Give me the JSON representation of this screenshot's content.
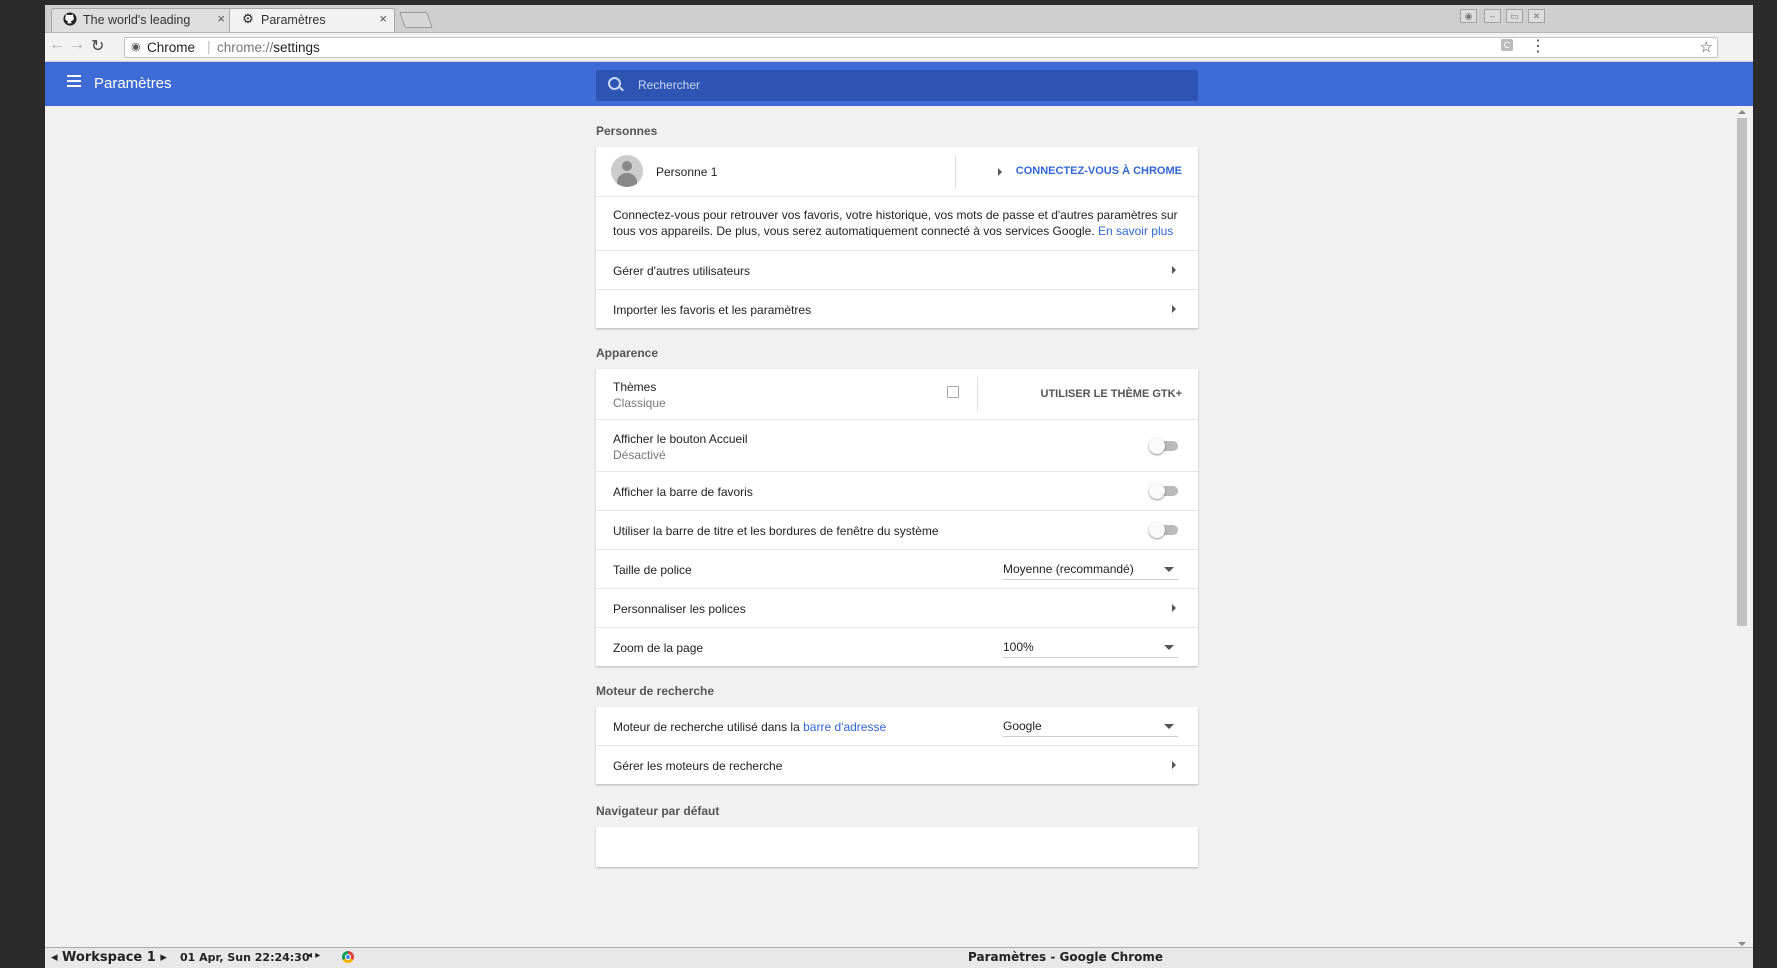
{
  "browser": {
    "tabs": [
      {
        "label": "The world's leading",
        "icon": "github-icon",
        "active": false
      },
      {
        "label": "Paramètres",
        "icon": "gear-icon",
        "active": true
      }
    ],
    "close_glyph": "×",
    "omnibox": {
      "chip": "Chrome",
      "separator": "|",
      "url_prefix": "chrome://",
      "url_path": "settings"
    }
  },
  "settings": {
    "header_title": "Paramètres",
    "search_placeholder": "Rechercher",
    "accent_color": "#3f6bd6",
    "sections": {
      "people": {
        "title": "Personnes",
        "person_name": "Personne 1",
        "sign_in_button": "CONNECTEZ-VOUS À CHROME",
        "description": "Connectez-vous pour retrouver vos favoris, votre historique, vos mots de passe et d'autres paramètres sur tous vos appareils. De plus, vous serez automatiquement connecté à vos services Google.",
        "learn_more": "En savoir plus",
        "manage_users": "Gérer d'autres utilisateurs",
        "import": "Importer les favoris et les paramètres"
      },
      "appearance": {
        "title": "Apparence",
        "themes_label": "Thèmes",
        "themes_value": "Classique",
        "gtk_button": "UTILISER LE THÈME GTK+",
        "home_button_label": "Afficher le bouton Accueil",
        "home_button_state": "Désactivé",
        "home_button_on": false,
        "bookmarks_bar_label": "Afficher la barre de favoris",
        "bookmarks_bar_on": false,
        "system_titlebar_label": "Utiliser la barre de titre et les bordures de fenêtre du système",
        "system_titlebar_on": false,
        "font_size_label": "Taille de police",
        "font_size_value": "Moyenne (recommandé)",
        "customize_fonts": "Personnaliser les polices",
        "zoom_label": "Zoom de la page",
        "zoom_value": "100%"
      },
      "search_engine": {
        "title": "Moteur de recherche",
        "engine_label_prefix": "Moteur de recherche utilisé dans la",
        "engine_label_link": "barre d'adresse",
        "engine_value": "Google",
        "manage_engines": "Gérer les moteurs de recherche"
      },
      "default_browser": {
        "title": "Navigateur par défaut"
      }
    }
  },
  "taskbar": {
    "workspace": "◂ Workspace 1 ▸",
    "clock": "01 Apr, Sun 22:24:30",
    "nav_arrows": "◂ ▸",
    "window_title": "Paramètres - Google Chrome"
  }
}
